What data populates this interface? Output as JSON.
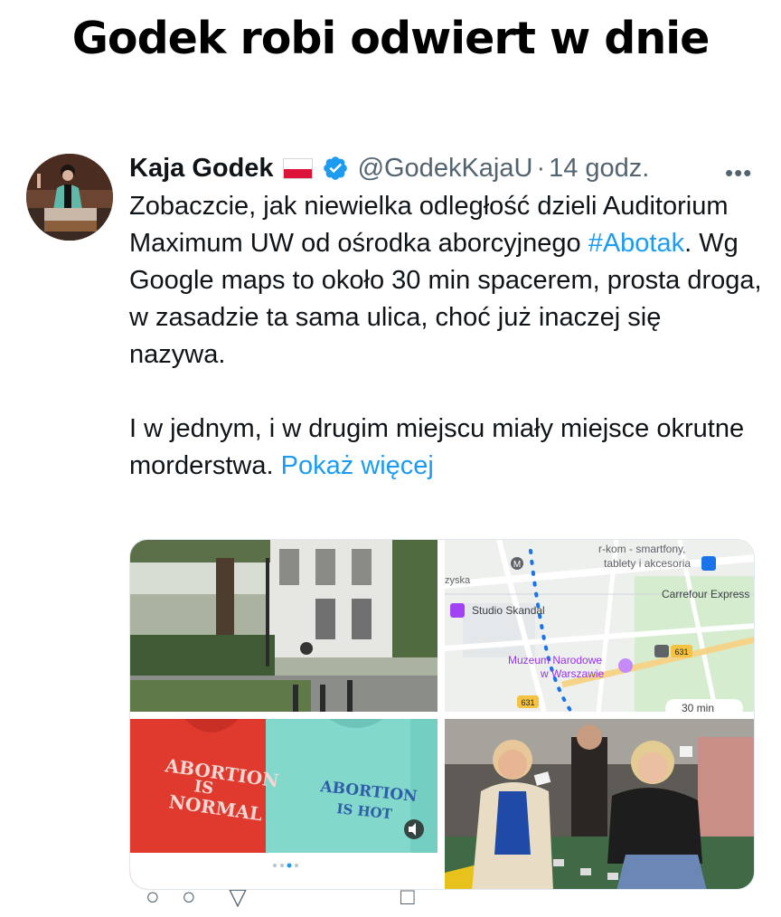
{
  "headline": "Godek robi odwiert w dnie",
  "tweet": {
    "author_name": "Kaja Godek",
    "handle": "@GodekKajaU",
    "separator": "·",
    "time": "14 godz.",
    "more_label": "•••",
    "text_p1_part1": "Zobaczcie, jak niewielka odległość dzieli Auditorium Maximum UW od ośrodka aborcyjnego ",
    "hashtag": "#Abotak",
    "text_p1_part2": ". Wg Google maps to około 30 min spacerem, prosta droga, w zasadzie ta sama ulica, choć już inaczej się nazywa.",
    "text_p2": "I w jednym, i w drugim miejscu miały miejsce okrutne morderstwa. ",
    "show_more": "Pokaż więcej"
  },
  "media": {
    "map_labels": {
      "place_rkom": "r-kom - smartfony,",
      "place_rkom2": "tablety i akcesoria",
      "street": "zyska",
      "carrefour": "Carrefour Express",
      "studio": "Studio Skandal",
      "museum1": "Muzeum Narodowe",
      "museum2": "w Warszawie",
      "route_badge_1": "631",
      "route_badge_2": "631",
      "metro": "M",
      "walk_time": "30 min"
    },
    "shirt1": [
      "ABORTION",
      "IS",
      "NORMAL"
    ],
    "shirt2": [
      "ABORTION",
      "IS HOT"
    ]
  },
  "colors": {
    "link": "#1d9bf0",
    "secondary_text": "#536471",
    "verified": "#1d9bf0",
    "flag_red": "#dc143c"
  }
}
